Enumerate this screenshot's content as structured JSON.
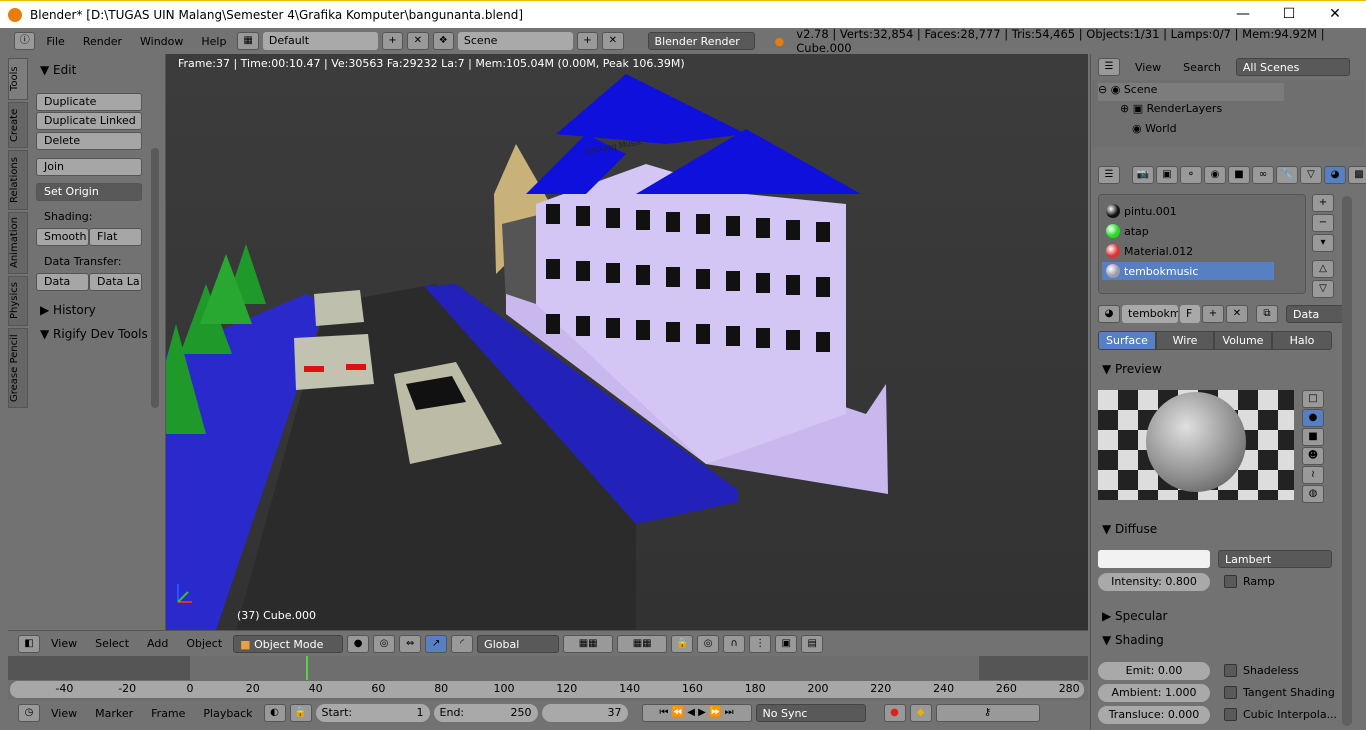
{
  "window": {
    "title": "Blender* [D:\\TUGAS UIN Malang\\Semester 4\\Grafika Komputer\\bangunanta.blend]",
    "min": "—",
    "max": "☐",
    "close": "✕"
  },
  "header": {
    "menus": [
      "File",
      "Render",
      "Window",
      "Help"
    ],
    "layout": "Default",
    "scene": "Scene",
    "engine": "Blender Render",
    "stats": "v2.78 | Verts:32,854 | Faces:28,777 | Tris:54,465 | Objects:1/31 | Lamps:0/7 | Mem:94.92M | Cube.000"
  },
  "toolshelf": {
    "tabs": [
      "Tools",
      "Create",
      "Relations",
      "Animation",
      "Physics",
      "Grease Pencil"
    ],
    "edit_header": "Edit",
    "buttons": [
      "Duplicate",
      "Duplicate Linked",
      "Delete",
      "Join"
    ],
    "set_origin": "Set Origin",
    "shading_label": "Shading:",
    "smooth": "Smooth",
    "flat": "Flat",
    "data_transfer_label": "Data Transfer:",
    "data": "Data",
    "data_layout": "Data La",
    "history": "History",
    "rigify": "Rigify Dev Tools"
  },
  "viewport": {
    "info": "Frame:37 | Time:00:10.47 | Ve:30563 Fa:29232 La:7 | Mem:105.04M (0.00M, Peak 106.39M)",
    "object": "(37) Cube.000",
    "sign_text": "Gedung Musik"
  },
  "viewport_header": {
    "menus": [
      "View",
      "Select",
      "Add",
      "Object"
    ],
    "mode": "Object Mode",
    "orientation": "Global"
  },
  "timeline": {
    "ticks": [
      -40,
      -20,
      0,
      20,
      40,
      60,
      80,
      100,
      120,
      140,
      160,
      180,
      200,
      220,
      240,
      260,
      280
    ],
    "current_frame": 37,
    "range_start": 0,
    "range_end": 250,
    "menus": [
      "View",
      "Marker",
      "Frame",
      "Playback"
    ],
    "start_label": "Start:",
    "start": "1",
    "end_label": "End:",
    "end": "250",
    "frame": "37",
    "sync": "No Sync"
  },
  "outliner": {
    "menus": [
      "View",
      "Search"
    ],
    "filter": "All Scenes",
    "items": [
      "Scene",
      "RenderLayers",
      "World"
    ]
  },
  "properties": {
    "materials": [
      {
        "name": "pintu.001",
        "color": "#111111"
      },
      {
        "name": "atap",
        "color": "#22dd22"
      },
      {
        "name": "Material.012",
        "color": "#e03030"
      },
      {
        "name": "tembokmusic",
        "color": "#9a9aaa"
      }
    ],
    "selected_material": "tembokmusic",
    "material_field": "tembokm",
    "fake_user": "F",
    "data_select": "Data",
    "tabs": [
      "Surface",
      "Wire",
      "Volume",
      "Halo"
    ],
    "active_tab": "Surface",
    "preview": "Preview",
    "diffuse": "Diffuse",
    "shader": "Lambert",
    "intensity_label": "Intensity:",
    "intensity": "0.800",
    "ramp": "Ramp",
    "specular": "Specular",
    "shading": "Shading",
    "emit_label": "Emit:",
    "emit": "0.00",
    "ambient_label": "Ambient:",
    "ambient": "1.000",
    "transluce_label": "Transluce:",
    "transluce": "0.000",
    "shadeless": "Shadeless",
    "tangent": "Tangent Shading",
    "cubic": "Cubic Interpola..."
  }
}
